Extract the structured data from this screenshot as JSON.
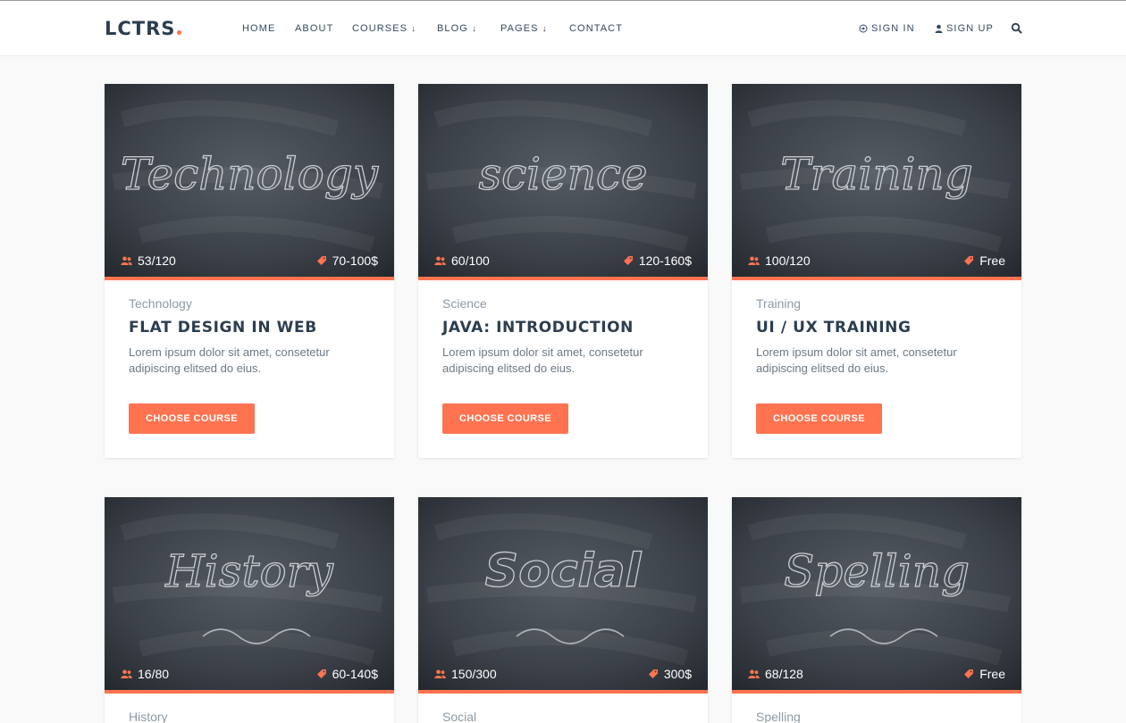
{
  "logo": "LCTRS",
  "nav": {
    "home": "HOME",
    "about": "ABOUT",
    "courses": "COURSES",
    "blog": "BLOG",
    "pages": "PAGES",
    "contact": "CONTACT",
    "sign_in": "SIGN IN",
    "sign_up": "SIGN UP"
  },
  "colors": {
    "accent": "#ff7350",
    "heading": "#2c3e50",
    "board": "#3a3f47"
  },
  "cards": [
    {
      "board_word": "Technology",
      "students": "53/120",
      "price": "70-100$",
      "category": "Technology",
      "title": "FLAT DESIGN IN WEB",
      "desc": "Lorem ipsum dolor sit amet, consetetur adipiscing elitsed do eius.",
      "button": "CHOOSE COURSE"
    },
    {
      "board_word": "science",
      "students": "60/100",
      "price": "120-160$",
      "category": "Science",
      "title": "JAVA: INTRODUCTION",
      "desc": "Lorem ipsum dolor sit amet, consetetur adipiscing elitsed do eius.",
      "button": "CHOOSE COURSE"
    },
    {
      "board_word": "Training",
      "students": "100/120",
      "price": "Free",
      "category": "Training",
      "title": "UI / UX TRAINING",
      "desc": "Lorem ipsum dolor sit amet, consetetur adipiscing elitsed do eius.",
      "button": "CHOOSE COURSE"
    },
    {
      "board_word": "History",
      "students": "16/80",
      "price": "60-140$",
      "category": "History",
      "title": "",
      "desc": "",
      "button": ""
    },
    {
      "board_word": "Social",
      "students": "150/300",
      "price": "300$",
      "category": "Social",
      "title": "",
      "desc": "",
      "button": ""
    },
    {
      "board_word": "Spelling",
      "students": "68/128",
      "price": "Free",
      "category": "Spelling",
      "title": "",
      "desc": "",
      "button": ""
    }
  ]
}
